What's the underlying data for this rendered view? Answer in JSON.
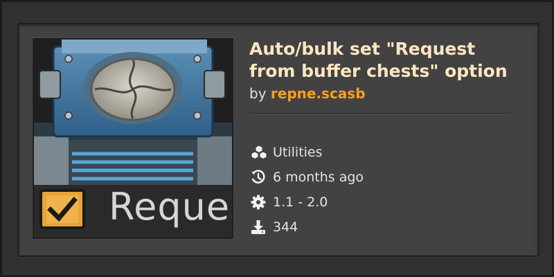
{
  "mod": {
    "title": "Auto/bulk set \"Request from buffer chests\" option",
    "by_label": "by",
    "author": "repne.scasb",
    "thumbnail_text": "Reques",
    "thumbnail_checkbox_checked": true
  },
  "meta": {
    "category": "Utilities",
    "updated": "6 months ago",
    "versions": "1.1 - 2.0",
    "downloads": "344"
  },
  "icons": {
    "category": "cubes-icon",
    "updated": "history-icon",
    "versions": "gear-icon",
    "downloads": "download-icon"
  },
  "colors": {
    "title": "#ffe6c0",
    "author": "#ff9f1b",
    "panel": "#424242",
    "text": "#e4e4e4"
  }
}
